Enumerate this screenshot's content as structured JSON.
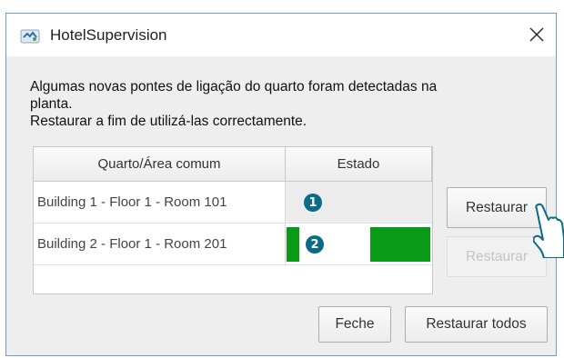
{
  "window": {
    "title": "HotelSupervision",
    "close_symbol": "✕"
  },
  "message": {
    "line1": "Algumas novas pontes de ligação do quarto foram detectadas na",
    "line2": "planta.",
    "line3": "Restaurar a fim de utilizá-las correctamente."
  },
  "table": {
    "headers": [
      "Quarto/Área comum",
      "Estado"
    ],
    "rows": [
      {
        "room": "Building 1 - Floor 1 - Room 101",
        "badge": "1",
        "button": "Restaurar",
        "button_enabled": true
      },
      {
        "room": "Building 2 - Floor 1 - Room 201",
        "badge": "2",
        "button": "Restaurar",
        "button_enabled": false,
        "status_color": "#0a9a16"
      }
    ]
  },
  "footer": {
    "close_label": "Feche",
    "restore_all_label": "Restaurar todos"
  },
  "colors": {
    "accent_badge": "#0a6b86",
    "status_green": "#0a9a16"
  }
}
